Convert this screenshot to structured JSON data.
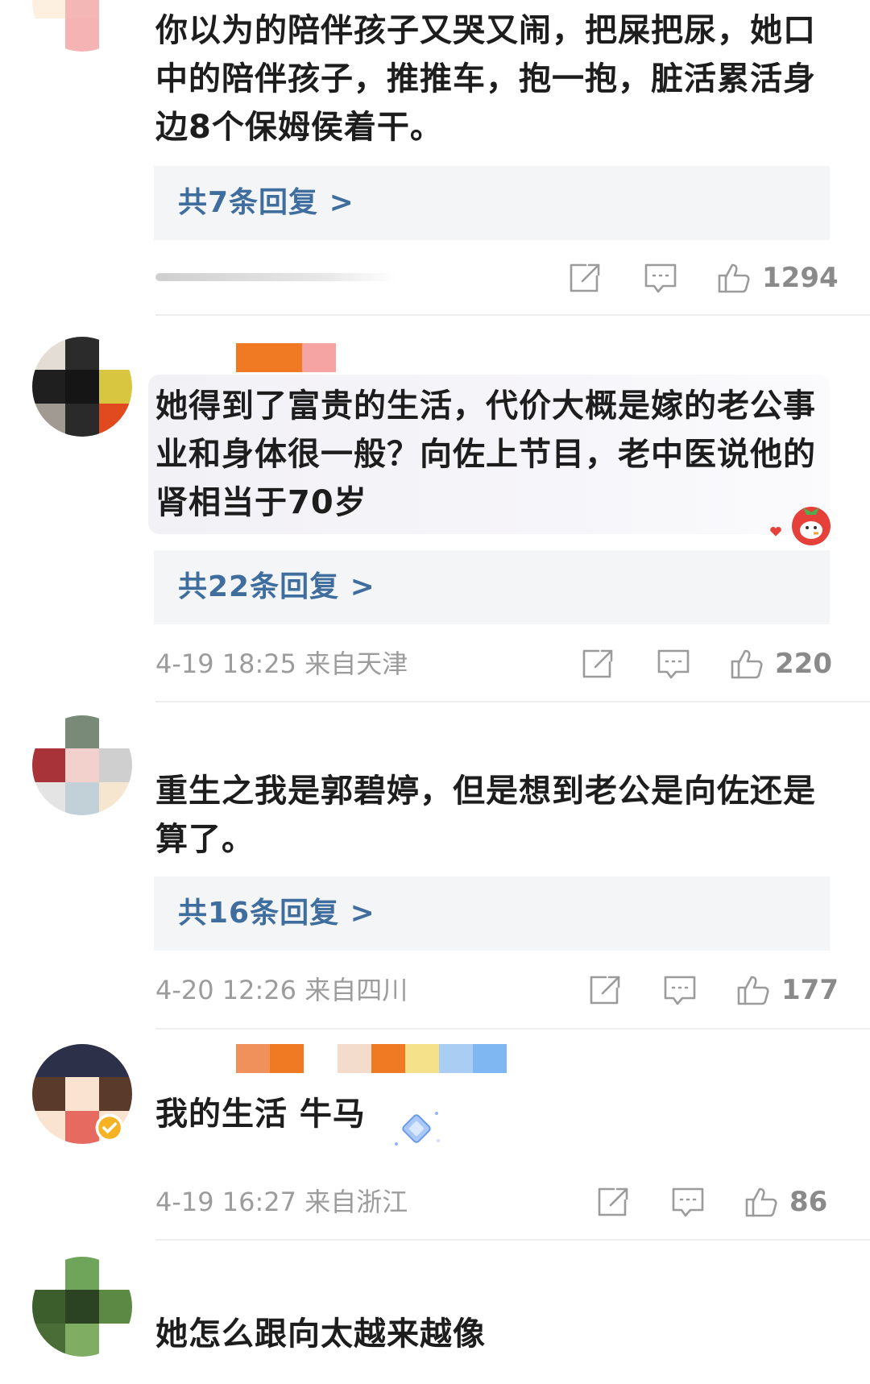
{
  "comments": [
    {
      "text": "你以为的陪伴孩子又哭又闹，把屎把尿，她口中的陪伴孩子，推推车，抱一抱，脏活累活身边8个保姆侯着干。",
      "reply_link": "共7条回复 >",
      "time": "",
      "likes": "1294"
    },
    {
      "text": "她得到了富贵的生活，代价大概是嫁的老公事业和身体很一般？向佐上节目，老中医说他的肾相当于70岁",
      "reply_link": "共22条回复 >",
      "time": "4-19 18:25 来自天津",
      "likes": "220"
    },
    {
      "text": "重生之我是郭碧婷，但是想到老公是向佐还是算了。",
      "reply_link": "共16条回复 >",
      "time": "4-20 12:26 来自四川",
      "likes": "177"
    },
    {
      "text": "我的生活 牛马",
      "reply_link": "",
      "time": "4-19 16:27 来自浙江",
      "likes": "86"
    },
    {
      "text": "她怎么跟向太越来越像",
      "reply_link": "",
      "time": "",
      "likes": ""
    }
  ],
  "colors": {
    "reply_link": "#3f6e9e",
    "meta_text": "#9c9c9c",
    "reply_box_bg": "#f4f5f7",
    "verified_badge": "#f5b324"
  },
  "icons": [
    "share-icon",
    "comment-icon",
    "like-icon",
    "verified-badge-icon",
    "strawberry-sticker-icon",
    "diamond-sticker-icon",
    "heart-icon"
  ]
}
